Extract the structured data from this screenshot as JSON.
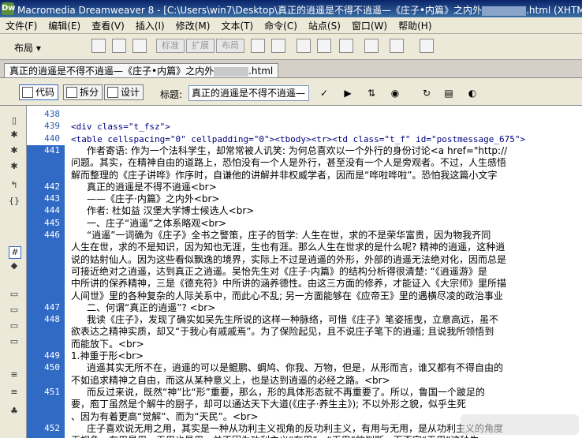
{
  "window": {
    "title": "Macromedia Dreamweaver 8 - [C:\\Users\\win7\\Desktop\\真正的逍遥是不得不逍遥—《庄子•内篇》之内外",
    "title_tail": ".html (XHTML)]",
    "logo_text": "Dw"
  },
  "menu": [
    "文件(F)",
    "编辑(E)",
    "查看(V)",
    "插入(I)",
    "修改(M)",
    "文本(T)",
    "命令(C)",
    "站点(S)",
    "窗口(W)",
    "帮助(H)"
  ],
  "toolbar": {
    "category": "布局",
    "mode_buttons": [
      "标准",
      "扩展",
      "布局"
    ]
  },
  "document_tab": {
    "name": "真正的逍遥是不得不逍遥—《庄子•内篇》之内外",
    "ext": ".html"
  },
  "view_buttons": {
    "code": "代码",
    "split": "拆分",
    "design": "设计"
  },
  "title_field": {
    "label": "标题:",
    "value": "真正的逍遥是不得不逍遥—《"
  },
  "code_lines": [
    {
      "num": "438",
      "text": ""
    },
    {
      "num": "439",
      "text": "<div class=\"t_fsz\">"
    },
    {
      "num": "440",
      "text": "<table cellspacing=\"0\" cellpadding=\"0\"><tbody><tr><td class=\"t_f\" id=\"postmessage_675\">"
    },
    {
      "num": "441",
      "text": "作者寄语: 作为一个法科学生，却常常被人讥笑: 为何总喜欢以一个外行的身份讨论<a href=\"http://"
    },
    {
      "num": "",
      "text": "问题。其实，在精神自由的道路上，恐怕没有一个人是外行，甚至没有一个人是旁观者。不过，人生感悟"
    },
    {
      "num": "",
      "text": "解而整理的《庄子讲哗》作序时，自谦他的讲解并非权威学者，因而是“哗啦哗啦”。恐怕我这篇小文字"
    },
    {
      "num": "442",
      "text": "真正的逍遥是不得不逍遥<br>"
    },
    {
      "num": "443",
      "text": "——《庄子·内篇》之内外<br>"
    },
    {
      "num": "444",
      "text": "作者: 杜如益 汉堡大学博士候选人<br>"
    },
    {
      "num": "445",
      "text": "一、庄子“逍遥”之体系略观<br>"
    },
    {
      "num": "446",
      "text": "“逍遥”一词确为《庄子》全书之警策，庄子的哲学: 人生在世，求的不是荣华富贵，因为物我齐同"
    },
    {
      "num": "",
      "text": "人生在世，求的不是知识，因为知也无涯，生也有涯。那么人生在世求的是什么呢? 精神的逍遥，这种逍"
    },
    {
      "num": "",
      "text": "说的姑射仙人。因为这些看似飘逸的境界，实际上不过是逍遥的外形，外部的逍遥无法绝对化，因而总是"
    },
    {
      "num": "",
      "text": "可接近绝对之逍遥，达到真正之逍遥。吴怡先生对《庄子·内篇》的结构分析得很清楚: “《逍遥游》是"
    },
    {
      "num": "",
      "text": "中所讲的保养精神，三是《德充符》中所讲的涵养德性。由这三方面的修养，才能证入《大宗师》里所描"
    },
    {
      "num": "",
      "text": "人间世》里的各种复杂的人际关系中，而此心不乱; 另一方面能够在《应帝王》里的遇横尽凌的政治事业"
    },
    {
      "num": "447",
      "text": "二、何谓“真正的逍遥”? <br>"
    },
    {
      "num": "448",
      "text": "我读《庄子》，发现了确实如吴先生所说的这样一种脉络，可惜《庄子》笔姿摇曳，立意高远，虽不"
    },
    {
      "num": "",
      "text": "欲表达之精神实质，却又“于我心有戚戚焉”。为了保险起见，且不说庄子笔下的逍遥; 且说我所领悟到"
    },
    {
      "num": "",
      "text": "而能放下。<br>"
    },
    {
      "num": "449",
      "text": "1.神重于形<br>"
    },
    {
      "num": "450",
      "text": "逍遥其实无所不在，逍遥的可以是鲲鹏、蜩鸠、你我、万物，但是，从形而言，谁又都有不得自由的"
    },
    {
      "num": "",
      "text": "不如追求精神之自由，而这从某种意义上，也是达到逍遥的必经之路。<br>"
    },
    {
      "num": "451",
      "text": "而反过来说，既然“神”比“形”重要，那么，形的具体形态就不再重要了。所以，鲁国一个跛足的"
    },
    {
      "num": "",
      "text": "要，庖丁虽然是个解牛的厨子，却可以通达天下大道(《庄子·养生主》); 不以外形之貌，似乎生死"
    },
    {
      "num": "",
      "text": "、因为有着更高“觉解”、而为“天民”。<br>"
    },
    {
      "num": "452",
      "text": "庄子喜欢说无用之用，其实是一种从功利主义视角的反功利主义，有用与无用，是从功利主义的角度"
    },
    {
      "num": "",
      "text": "无视角，有用是用，无用也是用，并不因为功利主义“有用”、“无用”的判断，而否定“无用”这种生"
    }
  ]
}
